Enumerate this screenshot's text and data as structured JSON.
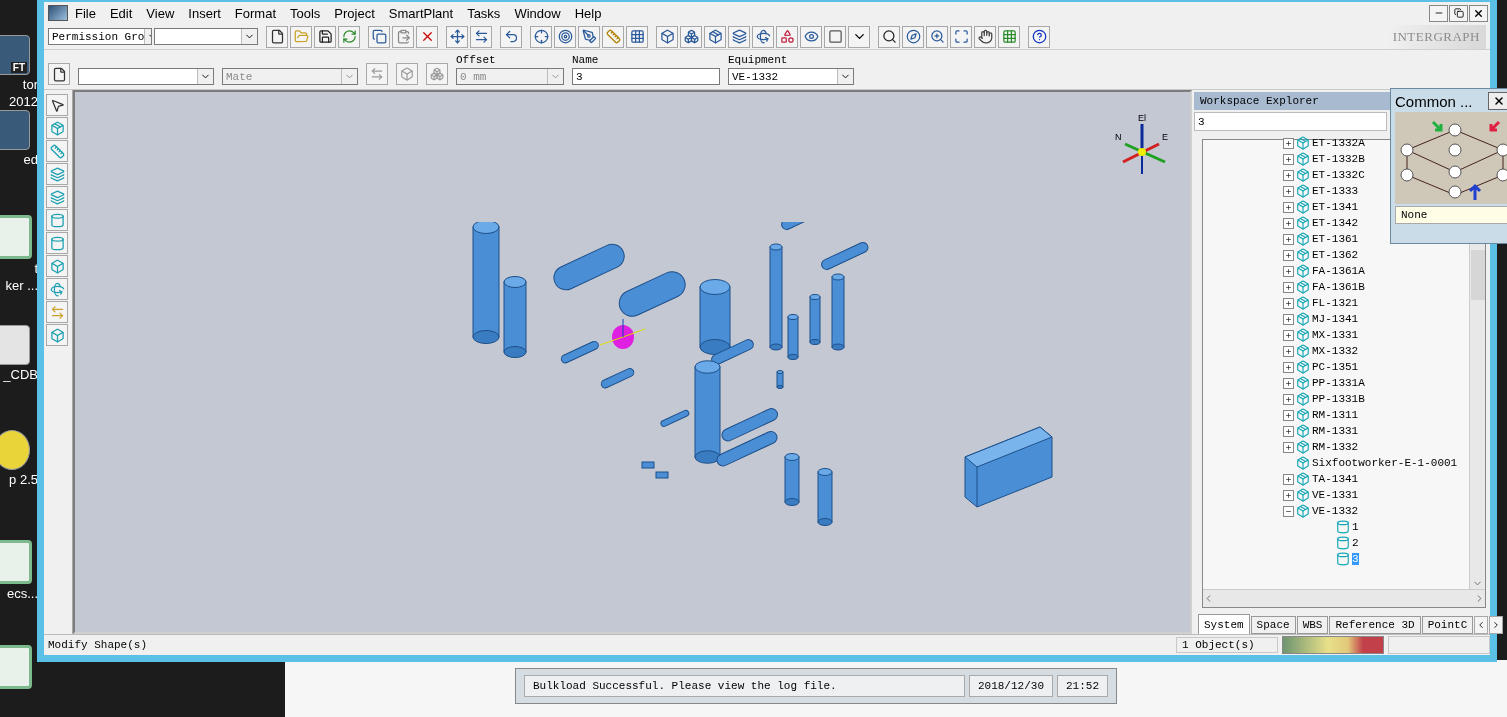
{
  "desktop_icons": [
    {
      "kind": "image",
      "badge": "FT",
      "lines": [
        "tor",
        "2012"
      ]
    },
    {
      "kind": "image",
      "lines": [
        "ed"
      ]
    },
    {
      "kind": "sheet",
      "lines": [
        "t",
        "ker ..."
      ]
    },
    {
      "kind": "doc",
      "lines": [
        "_CDB"
      ]
    },
    {
      "kind": "disc",
      "lines": [
        "p 2.5"
      ]
    },
    {
      "kind": "sheet",
      "lines": [
        "ecs..."
      ]
    },
    {
      "kind": "sheet"
    }
  ],
  "menu": [
    "File",
    "Edit",
    "View",
    "Insert",
    "Format",
    "Tools",
    "Project",
    "SmartPlant",
    "Tasks",
    "Window",
    "Help"
  ],
  "toolbar": {
    "combos": [
      {
        "value": "Permission Gro",
        "disabled": false
      },
      {
        "disabled": false
      }
    ],
    "logo": "INTERGRAPH"
  },
  "ribbon": {
    "combo_1": {
      "disabled": false
    },
    "mate": {
      "value": "Mate",
      "disabled": true
    },
    "offset": {
      "label": "Offset",
      "value": "0 mm",
      "disabled": true
    },
    "name": {
      "label": "Name",
      "value": "3"
    },
    "equipment": {
      "label": "Equipment",
      "value": "VE-1332"
    }
  },
  "viewport": {
    "compass": [
      "El",
      "N",
      "E"
    ]
  },
  "explorer": {
    "title": "Workspace Explorer",
    "filter": "3",
    "tree": [
      {
        "label": "ET-1332A",
        "expanded": false
      },
      {
        "label": "ET-1332B",
        "expanded": false
      },
      {
        "label": "ET-1332C",
        "expanded": false
      },
      {
        "label": "ET-1333",
        "expanded": false
      },
      {
        "label": "ET-1341",
        "expanded": false
      },
      {
        "label": "ET-1342",
        "expanded": false
      },
      {
        "label": "ET-1361",
        "expanded": false
      },
      {
        "label": "ET-1362",
        "expanded": false
      },
      {
        "label": "FA-1361A",
        "expanded": false
      },
      {
        "label": "FA-1361B",
        "expanded": false
      },
      {
        "label": "FL-1321",
        "expanded": false
      },
      {
        "label": "MJ-1341",
        "expanded": false
      },
      {
        "label": "MX-1331",
        "expanded": false
      },
      {
        "label": "MX-1332",
        "expanded": false
      },
      {
        "label": "PC-1351",
        "expanded": false
      },
      {
        "label": "PP-1331A",
        "expanded": false
      },
      {
        "label": "PP-1331B",
        "expanded": false
      },
      {
        "label": "RM-1311",
        "expanded": false
      },
      {
        "label": "RM-1331",
        "expanded": false
      },
      {
        "label": "RM-1332",
        "expanded": false
      },
      {
        "label": "Sixfootworker-E-1-0001"
      },
      {
        "label": "TA-1341",
        "expanded": false
      },
      {
        "label": "VE-1331",
        "expanded": false
      },
      {
        "label": "VE-1332",
        "expanded": true,
        "children": [
          {
            "label": "1",
            "selected": false
          },
          {
            "label": "2",
            "selected": false
          },
          {
            "label": "3",
            "selected": true
          }
        ]
      }
    ],
    "tabs": [
      {
        "label": "System",
        "selected": true
      },
      {
        "label": "Space",
        "selected": false
      },
      {
        "label": "WBS",
        "selected": false
      },
      {
        "label": "Reference 3D",
        "selected": false
      },
      {
        "label": "PointC",
        "selected": false
      }
    ]
  },
  "status_bar": {
    "message": "Modify Shape(s)",
    "count": "1 Object(s)"
  },
  "common_panel": {
    "title": "Common ...",
    "value": "None"
  },
  "background_window": {
    "message": "Bulkload Successful. Please view the log file.",
    "date": "2018/12/30",
    "time": "21:52"
  }
}
